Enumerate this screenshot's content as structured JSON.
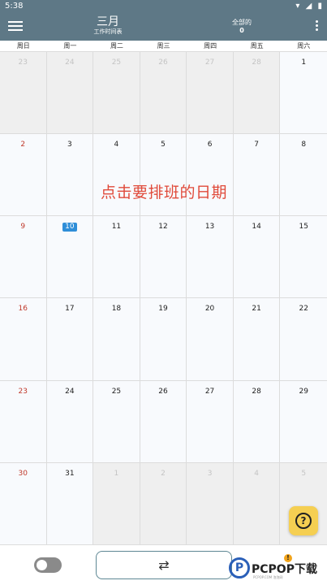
{
  "status_bar": {
    "time": "5:38",
    "icons": [
      "wifi-icon",
      "signal-icon",
      "battery-icon"
    ]
  },
  "app_bar": {
    "title": "三月",
    "subtitle": "工作时间表",
    "total_label": "全部的",
    "total_count": "0"
  },
  "weekdays": [
    "周日",
    "周一",
    "周二",
    "周三",
    "周四",
    "周五",
    "周六"
  ],
  "days": [
    {
      "n": "23",
      "t": "other"
    },
    {
      "n": "24",
      "t": "other"
    },
    {
      "n": "25",
      "t": "other"
    },
    {
      "n": "26",
      "t": "other"
    },
    {
      "n": "27",
      "t": "other"
    },
    {
      "n": "28",
      "t": "other"
    },
    {
      "n": "1",
      "t": "cur"
    },
    {
      "n": "2",
      "t": "cur"
    },
    {
      "n": "3",
      "t": "cur"
    },
    {
      "n": "4",
      "t": "cur"
    },
    {
      "n": "5",
      "t": "cur"
    },
    {
      "n": "6",
      "t": "cur"
    },
    {
      "n": "7",
      "t": "cur"
    },
    {
      "n": "8",
      "t": "cur"
    },
    {
      "n": "9",
      "t": "cur"
    },
    {
      "n": "10",
      "t": "today"
    },
    {
      "n": "11",
      "t": "cur"
    },
    {
      "n": "12",
      "t": "cur"
    },
    {
      "n": "13",
      "t": "cur"
    },
    {
      "n": "14",
      "t": "cur"
    },
    {
      "n": "15",
      "t": "cur"
    },
    {
      "n": "16",
      "t": "cur"
    },
    {
      "n": "17",
      "t": "cur"
    },
    {
      "n": "18",
      "t": "cur"
    },
    {
      "n": "19",
      "t": "cur"
    },
    {
      "n": "20",
      "t": "cur"
    },
    {
      "n": "21",
      "t": "cur"
    },
    {
      "n": "22",
      "t": "cur"
    },
    {
      "n": "23",
      "t": "cur"
    },
    {
      "n": "24",
      "t": "cur"
    },
    {
      "n": "25",
      "t": "cur"
    },
    {
      "n": "26",
      "t": "cur"
    },
    {
      "n": "27",
      "t": "cur"
    },
    {
      "n": "28",
      "t": "cur"
    },
    {
      "n": "29",
      "t": "cur"
    },
    {
      "n": "30",
      "t": "cur"
    },
    {
      "n": "31",
      "t": "cur"
    },
    {
      "n": "1",
      "t": "other"
    },
    {
      "n": "2",
      "t": "other"
    },
    {
      "n": "3",
      "t": "other"
    },
    {
      "n": "4",
      "t": "other"
    },
    {
      "n": "5",
      "t": "other"
    }
  ],
  "overlay_text": "点击要排班的日期",
  "help_button": {
    "icon": "help-icon",
    "label": "?"
  },
  "bottom_bar": {
    "swap_icon": "⇄",
    "toggle_state": "off"
  },
  "watermark": {
    "letter": "P",
    "text": "PCPOP下载",
    "badge": "!",
    "sub": "PCPOP.COM 泡泡网"
  },
  "colors": {
    "primary": "#5e7886",
    "today": "#2f8ed8",
    "sunday": "#c0392b",
    "help": "#f5cf52",
    "overlay": "#e04a3a"
  }
}
